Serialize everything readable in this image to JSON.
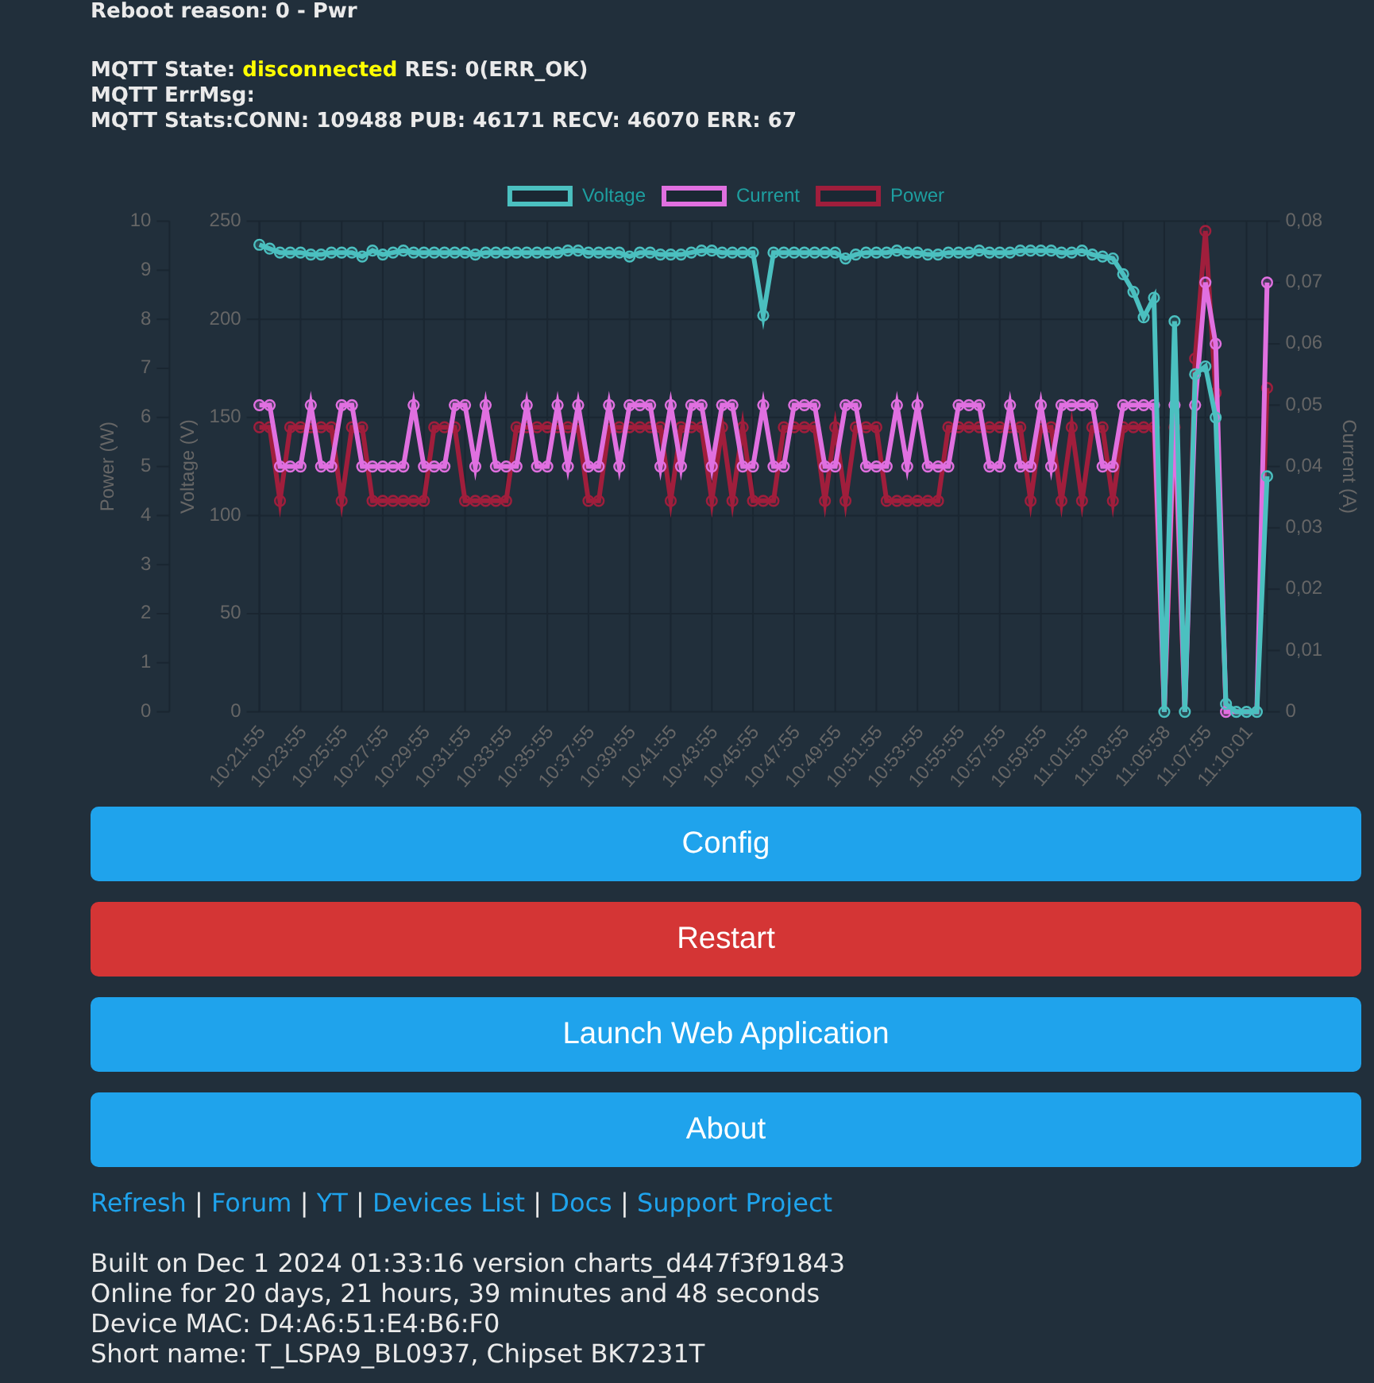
{
  "reboot_reason": "Reboot reason: 0 - Pwr",
  "mqtt": {
    "state_label": "MQTT State:",
    "state": "disconnected",
    "connected": false,
    "result": "RES: 0(ERR_OK)",
    "err_msg": "MQTT ErrMsg:",
    "stats": "MQTT Stats:CONN: 109488 PUB: 46171 RECV: 46070 ERR: 67"
  },
  "chart": {
    "layers": [
      {
        "kind": "main",
        "chart_data": {
          "type": "line",
          "ylabel": "Voltage (V)",
          "ylim": [
            0,
            250
          ],
          "yticks": [
            0,
            50,
            100,
            150,
            200,
            250
          ],
          "categories": [
            "10:21:55",
            null,
            null,
            null,
            "10:23:55",
            null,
            null,
            null,
            "10:25:55",
            null,
            null,
            null,
            "10:27:55",
            null,
            null,
            null,
            "10:29:55",
            null,
            null,
            null,
            "10:31:55",
            null,
            null,
            null,
            "10:33:55",
            null,
            null,
            null,
            "10:35:55",
            null,
            null,
            null,
            "10:37:55",
            null,
            null,
            null,
            "10:39:55",
            null,
            null,
            null,
            "10:41:55",
            null,
            null,
            null,
            "10:43:55",
            null,
            null,
            null,
            "10:45:55",
            null,
            null,
            null,
            "10:47:55",
            null,
            null,
            null,
            "10:49:55",
            null,
            null,
            null,
            "10:51:55",
            null,
            null,
            null,
            "10:53:55",
            null,
            null,
            null,
            "10:55:55",
            null,
            null,
            null,
            "10:57:55",
            null,
            null,
            null,
            "10:59:55",
            null,
            null,
            null,
            "11:01:55",
            null,
            null,
            null,
            "11:03:55",
            null,
            null,
            null,
            "11:05:58",
            null,
            null,
            null,
            "11:07:55",
            null,
            null,
            null,
            "11:10:01",
            null,
            null
          ],
          "series": [
            {
              "name": "Voltage",
              "color": "#4bc0c0",
              "marker": "circle",
              "values": [
                238,
                236,
                234,
                234,
                234,
                233,
                233,
                234,
                234,
                234,
                232,
                235,
                233,
                234,
                235,
                234,
                234,
                234,
                234,
                234,
                234,
                233,
                234,
                234,
                234,
                234,
                234,
                234,
                234,
                234,
                235,
                235,
                234,
                234,
                234,
                234,
                232,
                234,
                234,
                233,
                233,
                233,
                234,
                235,
                235,
                234,
                234,
                234,
                234,
                202,
                234,
                234,
                234,
                234,
                234,
                234,
                234,
                231,
                233,
                234,
                234,
                234,
                235,
                234,
                234,
                233,
                233,
                234,
                234,
                234,
                235,
                234,
                234,
                234,
                235,
                235,
                235,
                235,
                234,
                234,
                235,
                233,
                232,
                231,
                223,
                214,
                201,
                211,
                0,
                199,
                0,
                172,
                176,
                150,
                4,
                0,
                0,
                0,
                120
              ]
            }
          ]
        }
      },
      {
        "kind": "right",
        "chart_data": {
          "type": "line",
          "ylabel": "Current (A)",
          "ylim": [
            0,
            0.08
          ],
          "yticks": [
            {
              "value": 0,
              "label": "0"
            },
            {
              "value": 0.01,
              "label": "0,01"
            },
            {
              "value": 0.02,
              "label": "0,02"
            },
            {
              "value": 0.03,
              "label": "0,03"
            },
            {
              "value": 0.04,
              "label": "0,04"
            },
            {
              "value": 0.05,
              "label": "0,05"
            },
            {
              "value": 0.06,
              "label": "0,06"
            },
            {
              "value": 0.07,
              "label": "0,07"
            },
            {
              "value": 0.08,
              "label": "0,08"
            }
          ],
          "series": [
            {
              "name": "Current",
              "color": "#e070e0",
              "marker": "circle",
              "values": [
                0.05,
                0.05,
                0.04,
                0.04,
                0.04,
                0.05,
                0.04,
                0.04,
                0.05,
                0.05,
                0.04,
                0.04,
                0.04,
                0.04,
                0.04,
                0.05,
                0.04,
                0.04,
                0.04,
                0.05,
                0.05,
                0.04,
                0.05,
                0.04,
                0.04,
                0.04,
                0.05,
                0.04,
                0.04,
                0.05,
                0.04,
                0.05,
                0.04,
                0.04,
                0.05,
                0.04,
                0.05,
                0.05,
                0.05,
                0.04,
                0.05,
                0.04,
                0.05,
                0.05,
                0.04,
                0.05,
                0.05,
                0.04,
                0.04,
                0.05,
                0.04,
                0.04,
                0.05,
                0.05,
                0.05,
                0.04,
                0.04,
                0.05,
                0.05,
                0.04,
                0.04,
                0.04,
                0.05,
                0.04,
                0.05,
                0.04,
                0.04,
                0.04,
                0.05,
                0.05,
                0.05,
                0.04,
                0.04,
                0.05,
                0.04,
                0.04,
                0.05,
                0.04,
                0.05,
                0.05,
                0.05,
                0.05,
                0.04,
                0.04,
                0.05,
                0.05,
                0.05,
                0.05,
                0,
                0.05,
                0,
                0.05,
                0.07,
                0.06,
                0,
                0,
                0,
                0,
                0.07
              ]
            }
          ]
        }
      },
      {
        "kind": "left",
        "chart_data": {
          "type": "line",
          "ylabel": "Power (W)",
          "ylim": [
            0,
            10
          ],
          "yticks": [
            0,
            1,
            2,
            3,
            4,
            5,
            6,
            7,
            8,
            9,
            10
          ],
          "series": [
            {
              "name": "Power",
              "color": "#a01e3c",
              "marker": "circle",
              "values": [
                5.8,
                5.8,
                4.3,
                5.8,
                5.8,
                5.8,
                5.8,
                5.8,
                4.3,
                5.8,
                5.8,
                4.3,
                4.3,
                4.3,
                4.3,
                4.3,
                4.3,
                5.8,
                5.8,
                5.8,
                4.3,
                4.3,
                4.3,
                4.3,
                4.3,
                5.8,
                5.8,
                5.8,
                5.8,
                5.8,
                5.8,
                5.8,
                4.3,
                4.3,
                5.8,
                5.8,
                5.8,
                5.8,
                5.8,
                5.8,
                4.3,
                5.8,
                5.8,
                5.8,
                4.3,
                5.8,
                4.3,
                5.8,
                4.3,
                4.3,
                4.3,
                5.8,
                5.8,
                5.8,
                5.8,
                4.3,
                5.8,
                4.3,
                5.8,
                5.8,
                5.8,
                4.3,
                4.3,
                4.3,
                4.3,
                4.3,
                4.3,
                5.8,
                5.8,
                5.8,
                5.8,
                5.8,
                5.8,
                5.8,
                5.8,
                4.3,
                5.8,
                5.8,
                4.3,
                5.8,
                4.3,
                5.8,
                5.8,
                4.3,
                5.8,
                5.8,
                5.8,
                5.8,
                0,
                5.8,
                0,
                7.2,
                9.8,
                6.5,
                0,
                0,
                0,
                0,
                6.6
              ]
            }
          ]
        }
      }
    ]
  },
  "buttons": [
    {
      "label": "Config",
      "kind": "primary"
    },
    {
      "label": "Restart",
      "kind": "danger"
    },
    {
      "label": "Launch Web Application",
      "kind": "primary"
    },
    {
      "label": "About",
      "kind": "primary"
    }
  ],
  "links": [
    "Refresh",
    "Forum",
    "YT",
    "Devices List",
    "Docs",
    "Support Project"
  ],
  "link_separator": "|",
  "info": [
    "Built on Dec 1 2024 01:33:16 version charts_d447f3f91843",
    "Online for 20 days, 21 hours, 39 minutes and 48 seconds",
    "Device MAC: D4:A6:51:E4:B6:F0",
    "Short name: T_LSPA9_BL0937, Chipset BK7231T"
  ]
}
